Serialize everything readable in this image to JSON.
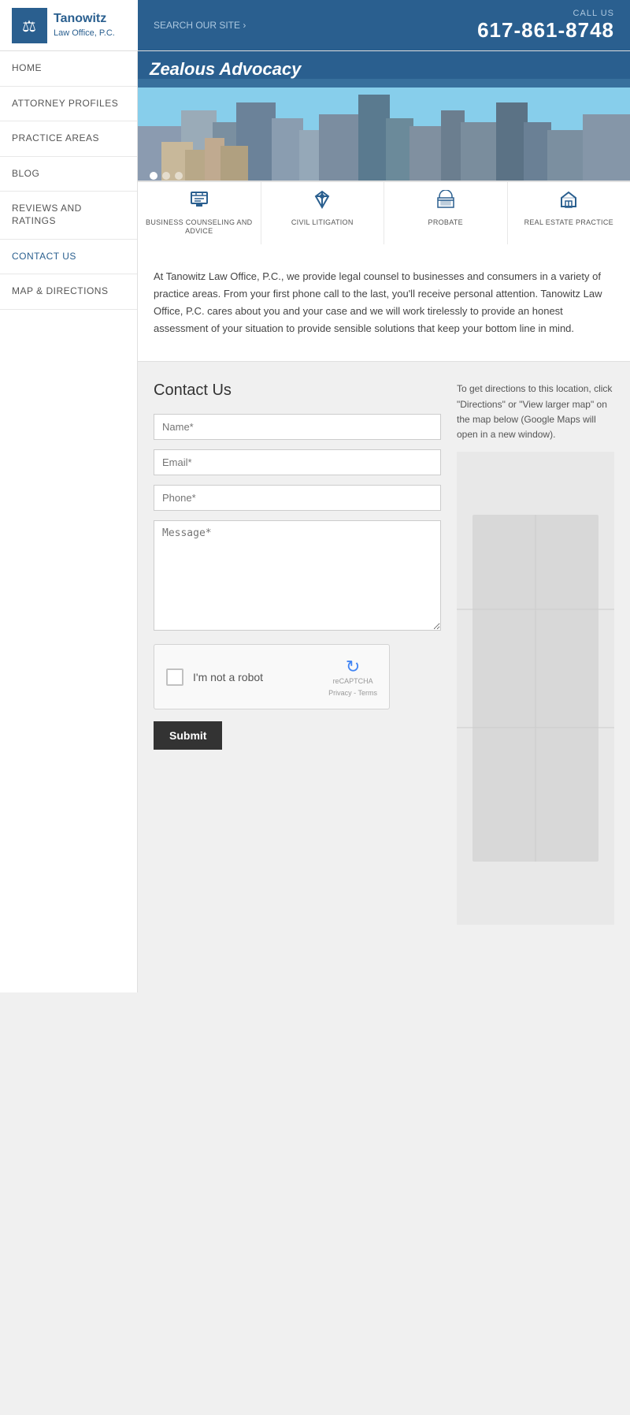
{
  "header": {
    "logo_name": "Tanowitz",
    "logo_subtitle": "Law Office, P.C.",
    "search_label": "SEARCH OUR SITE ›",
    "call_us_label": "CALL US",
    "phone": "617-861-8748"
  },
  "sidebar": {
    "items": [
      {
        "label": "HOME",
        "active": false
      },
      {
        "label": "ATTORNEY PROFILES",
        "active": false
      },
      {
        "label": "PRACTICE AREAS",
        "active": false
      },
      {
        "label": "BLOG",
        "active": false
      },
      {
        "label": "REVIEWS AND RATINGS",
        "active": false
      },
      {
        "label": "CONTACT US",
        "active": true
      },
      {
        "label": "MAP & DIRECTIONS",
        "active": false
      }
    ]
  },
  "hero": {
    "title": "Zealous Advocacy",
    "dots": [
      {
        "active": true
      },
      {
        "active": false
      },
      {
        "active": false
      }
    ]
  },
  "practice_areas": [
    {
      "label": "BUSINESS COUNSELING AND ADVICE",
      "icon": "📊"
    },
    {
      "label": "CIVIL LITIGATION",
      "icon": "⚖"
    },
    {
      "label": "PROBATE",
      "icon": "🏛"
    },
    {
      "label": "REAL ESTATE PRACTICE",
      "icon": "🏠"
    }
  ],
  "description": {
    "text": "At Tanowitz Law Office, P.C., we provide legal counsel to businesses and consumers in a variety of practice areas.  From your first phone call to the last, you'll receive personal attention.  Tanowitz Law Office, P.C. cares about you and your case and we will work tirelessly to provide an honest assessment of your situation to provide sensible solutions that keep your bottom line in mind."
  },
  "contact": {
    "title": "Contact Us",
    "name_placeholder": "Name*",
    "email_placeholder": "Email*",
    "phone_placeholder": "Phone*",
    "message_placeholder": "Message*",
    "recaptcha_label": "I'm not a robot",
    "recaptcha_brand": "reCAPTCHA",
    "recaptcha_privacy": "Privacy - Terms",
    "submit_label": "Submit",
    "map_text": "To get directions to this location, click \"Directions\" or \"View larger map\" on the map below (Google Maps will open in a new window)."
  }
}
